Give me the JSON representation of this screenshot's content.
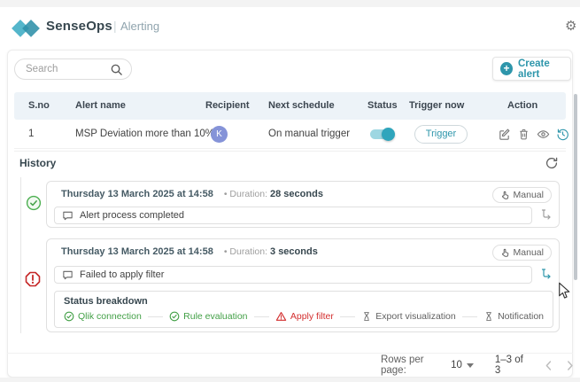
{
  "header": {
    "brand": "SenseOps",
    "divider": "|",
    "section": "Alerting"
  },
  "toolbar": {
    "search_placeholder": "Search",
    "create_alert": "Create alert",
    "plus_glyph": "+",
    "gear_glyph": "⚙"
  },
  "table": {
    "columns": [
      "S.no",
      "Alert name",
      "Recipient",
      "Next schedule",
      "Status",
      "Trigger now",
      "Action"
    ],
    "row": {
      "sno": "1",
      "alert_name": "MSP Deviation more than 10%",
      "recipient_initial": "K",
      "next_schedule": "On manual trigger",
      "status_toggle": "on",
      "trigger_button": "Trigger"
    }
  },
  "history": {
    "title": "History",
    "entries": [
      {
        "status": "success",
        "timestamp": "Thursday 13 March 2025 at 14:58",
        "duration_label": "• Duration:",
        "duration_value": "28 seconds",
        "badge": "Manual",
        "message": "Alert process completed"
      },
      {
        "status": "error",
        "timestamp": "Thursday 13 March 2025 at 14:58",
        "duration_label": "• Duration:",
        "duration_value": "3 seconds",
        "badge": "Manual",
        "message": "Failed to apply filter",
        "breakdown": {
          "title": "Status breakdown",
          "steps": [
            {
              "label": "Qlik connection",
              "state": "success"
            },
            {
              "label": "Rule evaluation",
              "state": "success"
            },
            {
              "label": "Apply filter",
              "state": "error"
            },
            {
              "label": "Export visualization",
              "state": "pending"
            },
            {
              "label": "Notification",
              "state": "pending"
            }
          ]
        }
      }
    ]
  },
  "pagination": {
    "rows_per_page_label": "Rows per page:",
    "rows_per_page_value": "10",
    "range": "1–3 of 3"
  },
  "colors": {
    "accent_teal": "#2e96ab",
    "toggle_teal": "#2fa5bc",
    "success_green": "#43a047",
    "error_red": "#c62828",
    "avatar_indigo": "#8593d8",
    "table_header_bg": "#edf3f8"
  },
  "icons": {
    "settings": "gear-glyph",
    "search": "magnifier-svg",
    "create": "plus-circle",
    "edit": "pencil-svg",
    "delete": "trash-svg",
    "view": "eye-svg",
    "history_restore": "clock-arrow-svg",
    "refresh": "circular-arrow-svg",
    "success": "check-circle-svg",
    "error": "octagon-exclamation-svg",
    "message": "speech-bubble-svg",
    "manual": "hand-pointer-svg",
    "expand_flow": "branch-arrow-svg",
    "warning": "triangle-exclamation-svg",
    "pending": "hourglass-svg"
  }
}
